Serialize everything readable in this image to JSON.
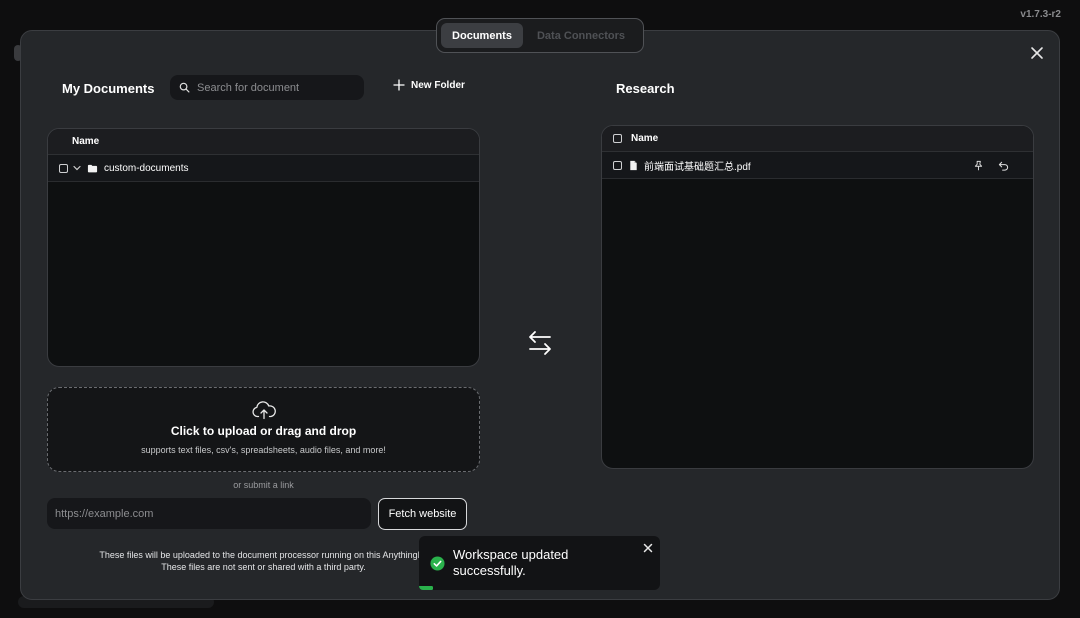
{
  "version": "v1.7.3-r2",
  "tabs": [
    {
      "label": "Documents",
      "active": true
    },
    {
      "label": "Data Connectors",
      "active": false
    }
  ],
  "my_documents": {
    "title": "My Documents",
    "search_placeholder": "Search for document",
    "new_folder_label": "New Folder",
    "column_name": "Name",
    "folders": [
      {
        "name": "custom-documents",
        "icon": "folder-icon"
      }
    ]
  },
  "upload": {
    "main_text": "Click to upload or drag and drop",
    "sub_text": "supports text files, csv's, spreadsheets, audio files, and more!",
    "or_link": "or submit a link",
    "url_placeholder": "https://example.com",
    "fetch_label": "Fetch website",
    "notice_line1": "These files will be uploaded to the document processor running on this AnythingLL",
    "notice_line2": "These files are not sent or shared with a third party."
  },
  "research": {
    "title": "Research",
    "column_name": "Name",
    "files": [
      {
        "name": "前端面试基础题汇总.pdf",
        "icon": "file-icon"
      }
    ]
  },
  "toast": {
    "message": "Workspace updated successfully.",
    "status_color": "#2ab24c",
    "progress": 0.06
  },
  "colors": {
    "modal_bg": "#25272a",
    "panel_bg": "#0e1011",
    "accent_success": "#2ab24c"
  }
}
